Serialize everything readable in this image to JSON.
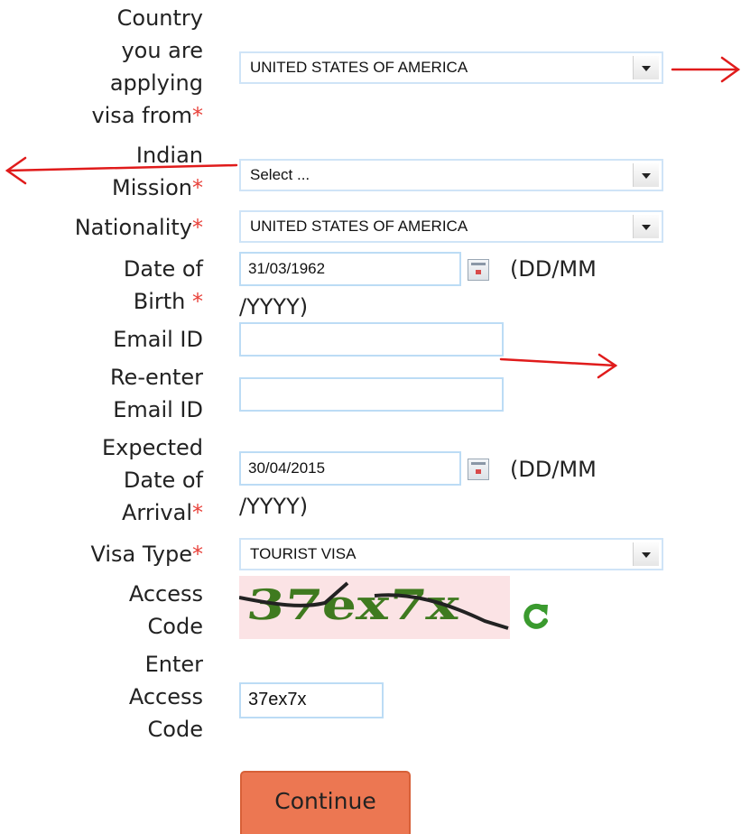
{
  "fields": {
    "country": {
      "label_lines": [
        "Country",
        "you are",
        "applying",
        "visa from"
      ],
      "value": "UNITED STATES OF AMERICA"
    },
    "mission": {
      "label_lines": [
        "Indian",
        "Mission"
      ],
      "value": "Select ..."
    },
    "nationality": {
      "label": "Nationality",
      "value": "UNITED STATES OF AMERICA"
    },
    "dob": {
      "label_lines": [
        "Date of",
        "Birth"
      ],
      "value": "31/03/1962",
      "format_line1": "(DD/MM",
      "format_line2": "/YYYY)"
    },
    "email": {
      "label": "Email ID",
      "value": ""
    },
    "reemail": {
      "label_lines": [
        "Re-enter",
        "Email ID"
      ],
      "value": ""
    },
    "arrival": {
      "label_lines": [
        "Expected",
        "Date of",
        "Arrival"
      ],
      "value": "30/04/2015",
      "format_line1": "(DD/MM",
      "format_line2": "/YYYY)"
    },
    "visa_type": {
      "label": "Visa Type",
      "value": "TOURIST VISA"
    },
    "access_code": {
      "label_lines": [
        "Access",
        "Code"
      ],
      "captcha_text": "37ex7x"
    },
    "enter_access_code": {
      "label_lines": [
        "Enter",
        "Access",
        "Code"
      ],
      "value": "37ex7x"
    }
  },
  "required_marker": "*",
  "continue_label": "Continue",
  "colors": {
    "required": "#e8413a",
    "button": "#ec7752",
    "annotation_arrow": "#e01b1b",
    "refresh_icon": "#3a9a2e"
  },
  "icons": [
    "calendar-icon",
    "refresh-icon",
    "dropdown-arrow-icon",
    "annotation-arrow"
  ]
}
